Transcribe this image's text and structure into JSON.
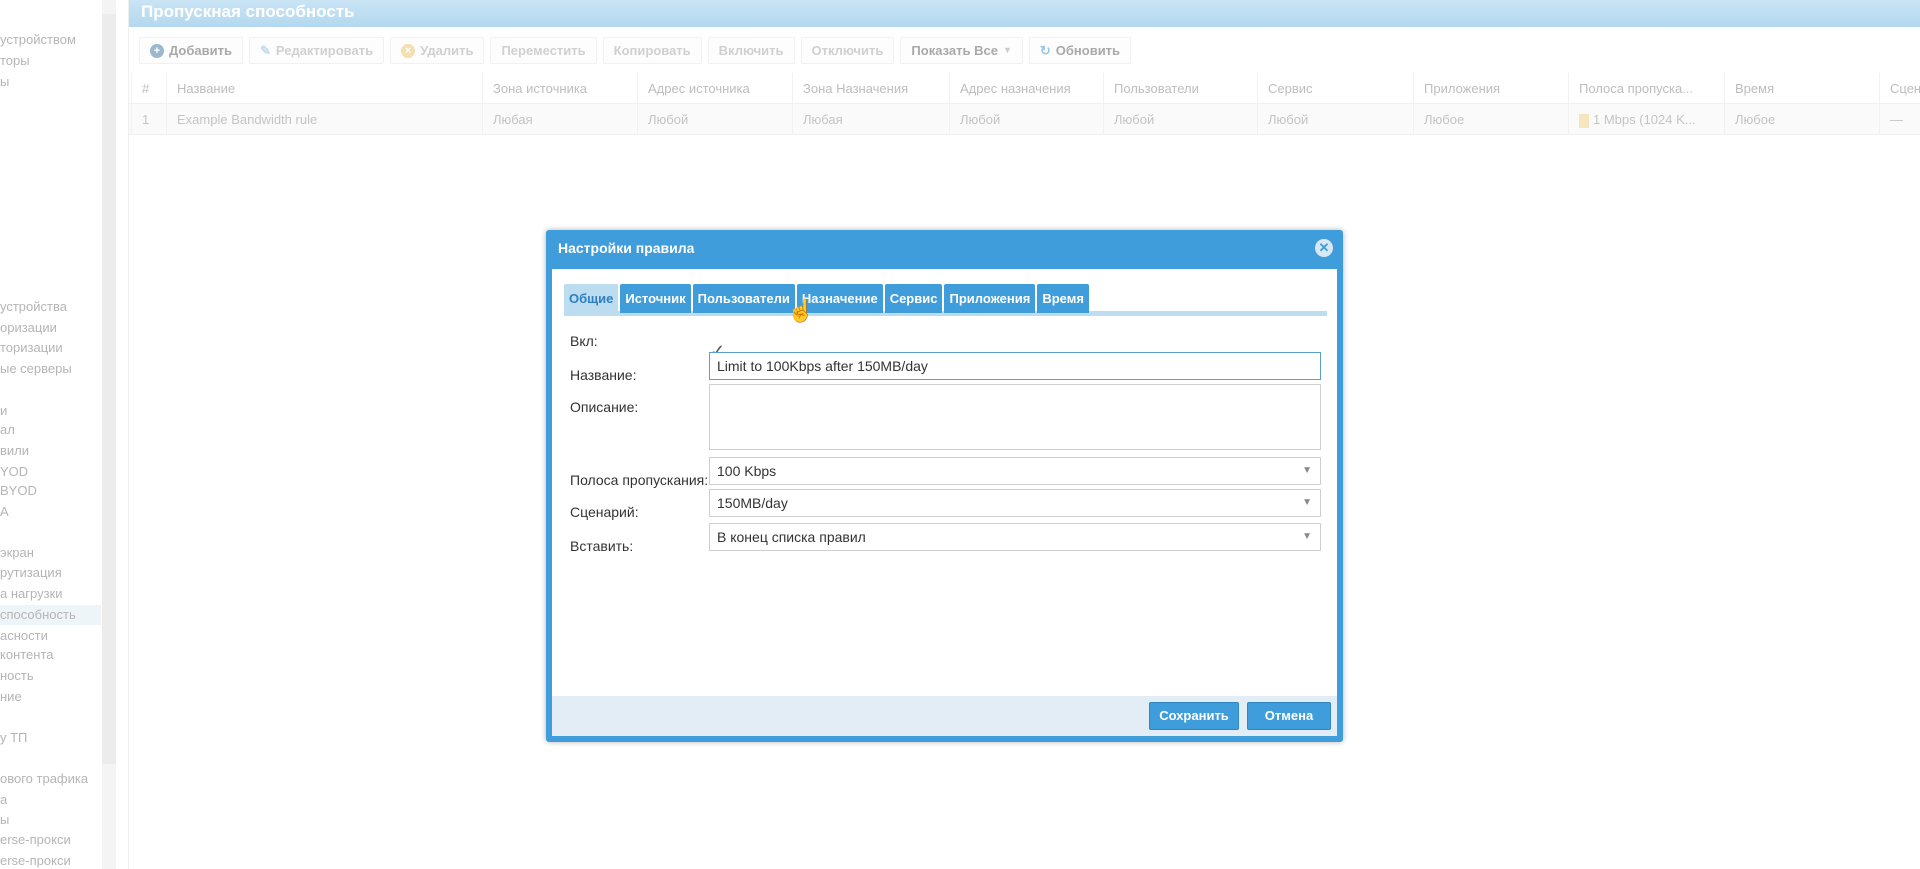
{
  "sidebar": {
    "items": [
      {
        "label": "устройством"
      },
      {
        "label": "торы"
      },
      {
        "label": "ы"
      },
      {
        "label": " устройства"
      },
      {
        "label": "оризации"
      },
      {
        "label": "торизации"
      },
      {
        "label": "ые серверы"
      },
      {
        "label": "и"
      },
      {
        "label": "ал"
      },
      {
        "label": "вили"
      },
      {
        "label": "YOD"
      },
      {
        "label": "BYOD"
      },
      {
        "label": "A"
      },
      {
        "label": "экран"
      },
      {
        "label": "рутизация"
      },
      {
        "label": "а нагрузки"
      },
      {
        "label": "способность"
      },
      {
        "label": "асности"
      },
      {
        "label": "контента"
      },
      {
        "label": "ность"
      },
      {
        "label": "ние"
      },
      {
        "label": "у ТП"
      },
      {
        "label": "ового трафика"
      },
      {
        "label": "а"
      },
      {
        "label": "ы"
      },
      {
        "label": "erse-прокси"
      },
      {
        "label": "erse-прокси"
      }
    ]
  },
  "page": {
    "title": "Пропускная способность"
  },
  "toolbar": {
    "add": "Добавить",
    "edit": "Редактировать",
    "delete": "Удалить",
    "move": "Переместить",
    "copy": "Копировать",
    "enable": "Включить",
    "disable": "Отключить",
    "show_all": "Показать Все",
    "refresh": "Обновить"
  },
  "grid": {
    "headers": [
      "#",
      "Название",
      "Зона источника",
      "Адрес источника",
      "Зона Назначения",
      "Адрес назначения",
      "Пользователи",
      "Сервис",
      "Приложения",
      "Полоса пропуска...",
      "Время",
      "Сцен"
    ],
    "rows": [
      [
        "1",
        "Example Bandwidth rule",
        "Любая",
        "Любой",
        "Любая",
        "Любой",
        "Любой",
        "Любой",
        "Любое",
        "1 Mbps (1024 K...",
        "Любое",
        "—"
      ]
    ]
  },
  "dialog": {
    "title": "Настройки правила",
    "tabs": [
      "Общие",
      "Источник",
      "Пользователи",
      "Назначение",
      "Сервис",
      "Приложения",
      "Время"
    ],
    "labels": {
      "enabled": "Вкл:",
      "name": "Название:",
      "description": "Описание:",
      "bandwidth": "Полоса пропускания:",
      "scenario": "Сценарий:",
      "insert": "Вставить:"
    },
    "values": {
      "enabled": true,
      "name": "Limit to 100Kbps after 150MB/day",
      "description": "",
      "bandwidth": "100 Kbps",
      "scenario": "150MB/day",
      "insert": "В конец списка правил"
    },
    "save": "Сохранить",
    "cancel": "Отмена"
  }
}
